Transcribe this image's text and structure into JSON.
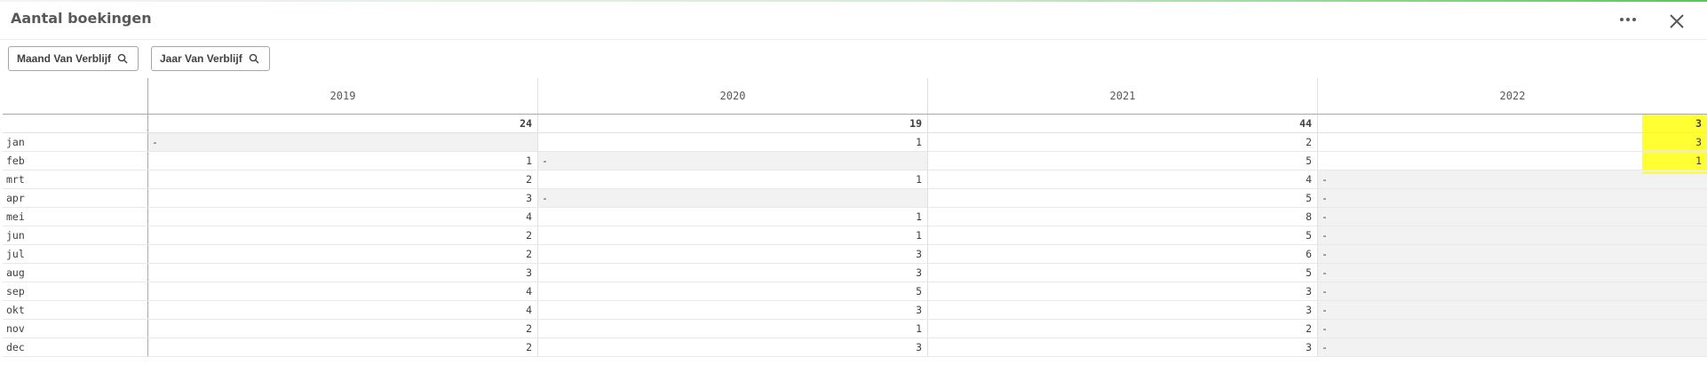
{
  "header": {
    "title": "Aantal boekingen",
    "more_icon": "ellipsis-icon",
    "close_icon": "close-icon"
  },
  "dimensions": [
    {
      "label": "Maand Van Verblijf",
      "icon": "search-icon"
    },
    {
      "label": "Jaar Van Verblijf",
      "icon": "search-icon"
    }
  ],
  "table": {
    "columns": [
      "2019",
      "2020",
      "2021",
      "2022"
    ],
    "totals": [
      "24",
      "19",
      "44",
      "3"
    ],
    "rows": [
      {
        "label": "jan",
        "values": [
          "-",
          "1",
          "2",
          "3"
        ]
      },
      {
        "label": "feb",
        "values": [
          "1",
          "-",
          "5",
          "1"
        ]
      },
      {
        "label": "mrt",
        "values": [
          "2",
          "1",
          "4",
          "-"
        ]
      },
      {
        "label": "apr",
        "values": [
          "3",
          "-",
          "5",
          "-"
        ]
      },
      {
        "label": "mei",
        "values": [
          "4",
          "1",
          "8",
          "-"
        ]
      },
      {
        "label": "jun",
        "values": [
          "2",
          "1",
          "5",
          "-"
        ]
      },
      {
        "label": "jul",
        "values": [
          "2",
          "3",
          "6",
          "-"
        ]
      },
      {
        "label": "aug",
        "values": [
          "3",
          "3",
          "5",
          "-"
        ]
      },
      {
        "label": "sep",
        "values": [
          "4",
          "5",
          "3",
          "-"
        ]
      },
      {
        "label": "okt",
        "values": [
          "4",
          "3",
          "3",
          "-"
        ]
      },
      {
        "label": "nov",
        "values": [
          "2",
          "1",
          "2",
          "-"
        ]
      },
      {
        "label": "dec",
        "values": [
          "2",
          "3",
          "3",
          "-"
        ]
      }
    ]
  },
  "colors": {
    "highlight": "#ffff33",
    "null_cell": "#f2f2f2",
    "accent_green": "#52cc52"
  }
}
